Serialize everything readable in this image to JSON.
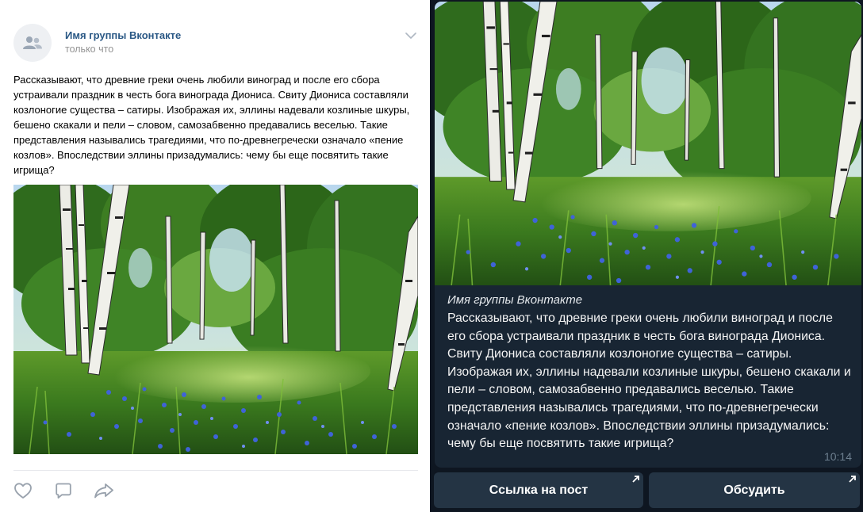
{
  "vk_post": {
    "group_name": "Имя группы Вконтакте",
    "timestamp": "только что",
    "text": "Рассказывают, что древние греки очень любили виноград и после его сбора устраивали праздник в честь бога винограда Диониса. Свиту Диониса составляли козлоногие существа – сатиры. Изображая их, эллины надевали козлиные шкуры, бешено скакали и пели – словом, самозабвенно предавались веселью. Такие представления назывались трагедиями, что по-древнегречески означало «пение козлов». Впоследствии эллины призадумались: чему бы еще посвятить такие игрища?",
    "icons": {
      "avatar": "community-icon",
      "menu": "chevron-down-icon",
      "like": "heart-icon",
      "comment": "comment-icon",
      "share": "share-icon"
    },
    "link_color": "#2a5885"
  },
  "telegram_post": {
    "author": "Имя группы Вконтакте",
    "message": "Рассказывают, что древние греки очень любили виноград и после его сбора устраивали праздник в честь бога винограда Диониса. Свиту Диониса составляли козлоногие существа – сатиры. Изображая их, эллины надевали козлиные шкуры, бешено скакали и пели – словом, самозабвенно предавались веселью. Такие представления назывались трагедиями, что по-древнегречески означало «пение козлов». Впоследствии эллины призадумались: чему бы еще посвятить такие игрища?",
    "time": "10:14",
    "buttons": [
      {
        "label": "Ссылка на пост",
        "icon": "external-arrow-icon"
      },
      {
        "label": "Обсудить",
        "icon": "external-arrow-icon"
      }
    ],
    "background_color": "#0e1621",
    "bubble_color": "#182533"
  }
}
